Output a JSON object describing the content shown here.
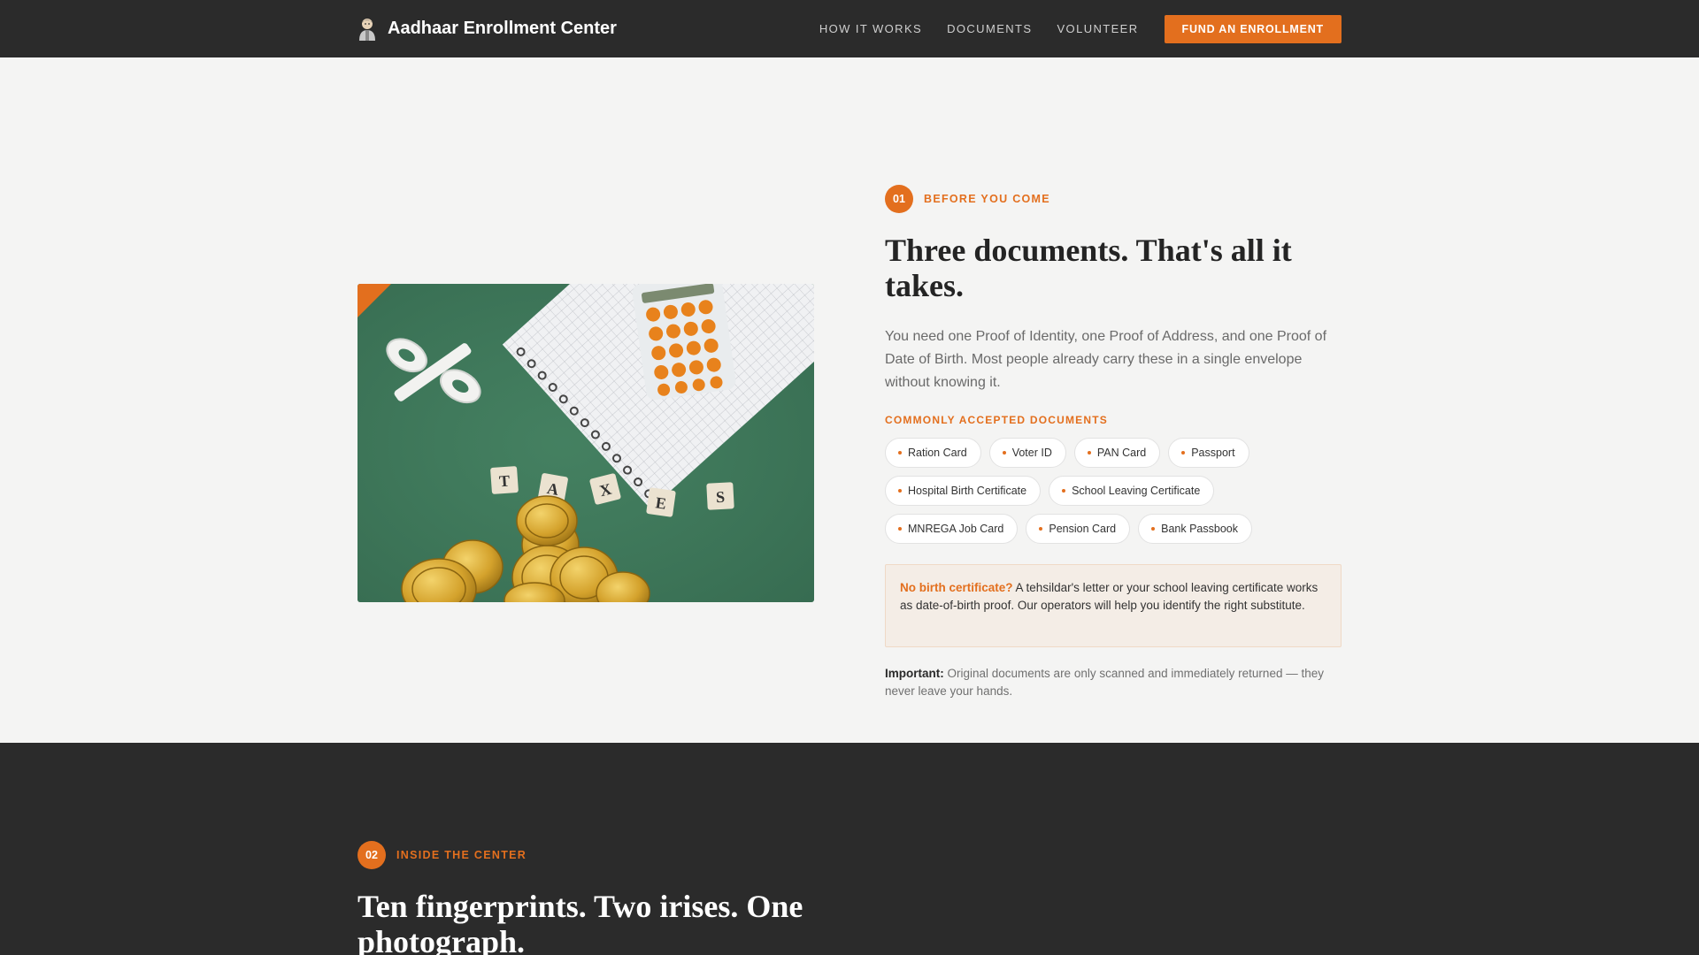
{
  "nav": {
    "title": "Aadhaar Enrollment Center",
    "links": [
      "HOW IT WORKS",
      "DOCUMENTS",
      "VOLUNTEER"
    ],
    "cta": "FUND AN ENROLLMENT",
    "logo_icon": "person-icon"
  },
  "section1": {
    "step_number": "01",
    "step_label": "BEFORE YOU COME",
    "heading": "Three documents. That's all it takes.",
    "lead": "You need one Proof of Identity, one Proof of Address, and one Proof of Date of Birth. Most people already carry these in a single envelope without knowing it.",
    "docs_label": "COMMONLY ACCEPTED DOCUMENTS",
    "documents": [
      "Ration Card",
      "Voter ID",
      "PAN Card",
      "Passport",
      "Hospital Birth Certificate",
      "School Leaving Certificate",
      "MNREGA Job Card",
      "Pension Card",
      "Bank Passbook"
    ],
    "note_strong": "No birth certificate?",
    "note_text": " A tehsildar's letter or your school leaving certificate works as date-of-birth proof. Our operators will help you identify the right substitute.",
    "important_strong": "Important:",
    "important_text": " Original documents are only scanned and immediately returned — they never leave your hands.",
    "image": {
      "tiles": [
        "T",
        "A",
        "X",
        "E",
        "S"
      ],
      "percent_symbol": "%"
    }
  },
  "section2": {
    "step_number": "02",
    "step_label": "INSIDE THE CENTER",
    "heading": "Ten fingerprints. Two irises. One photograph."
  },
  "colors": {
    "accent": "#e36f1e",
    "dark": "#2b2b2b",
    "page_bg": "#f4f4f3",
    "photo_green": "#3f7a5c"
  }
}
